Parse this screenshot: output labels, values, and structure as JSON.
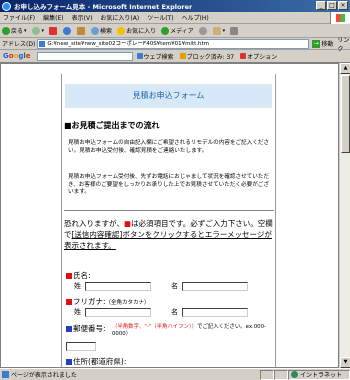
{
  "window": {
    "title": "お申し込みフォーム見本 - Microsoft Internet Explorer",
    "min": "_",
    "max": "□",
    "close": "×"
  },
  "menu": [
    "ファイル(F)",
    "編集(E)",
    "表示(V)",
    "お気に入り(A)",
    "ツール(T)",
    "ヘルプ(H)"
  ],
  "toolbar": {
    "back": "戻る",
    "forward": "",
    "search": "検索",
    "favorites": "お気に入り",
    "media": "メディア"
  },
  "address": {
    "label": "アドレス(D)",
    "value": "G:¥new_site¥new_site02コーポレーF40S¥tem¥01¥mitt.htm",
    "go": "移動",
    "links": "リンク"
  },
  "google": {
    "logo": [
      "G",
      "o",
      "o",
      "g",
      "l",
      "e"
    ],
    "web_search": "ウェブ検索",
    "blocked": "ブロック済み: 37",
    "options": "オプション"
  },
  "page": {
    "header": "見積お申込フォーム",
    "section_title": "■お見積ご提出までの流れ",
    "para1": "見積お申込フォームの自由記入欄にご希望されるリモデルの内容をご記入ください。見積お申込受付後、確認見積をご連絡いたします。",
    "para2": "見積お申込フォーム受付後、先ずお電話におじゃまして状況を確認させていただき、お客様のご要望をしっかりお承りした上でお見積させていただく必要がございます。",
    "notice_pre": "恐れ入りますが、",
    "notice_red": "■",
    "notice_mid": "は必須項目です。必ずご入力下さい。空欄で",
    "notice_u": "[送信内容確認]",
    "notice_post": "ボタンをクリックするとエラーメッセージが表示されます。",
    "name_label": "氏名:",
    "sei": "姓",
    "mei": "名",
    "furigana_label": "フリガナ:",
    "furigana_sub": "（全角カタカナ）",
    "zip_label": "郵便番号:",
    "zip_note_red": "（半角数字、\"-\"（半角ハイフン））",
    "zip_note": "でご記入ください。ex.000-0000）",
    "address_label": "住所(都道府県):"
  },
  "status": {
    "text": "ページが表示されました",
    "zone": "イントラネット"
  }
}
